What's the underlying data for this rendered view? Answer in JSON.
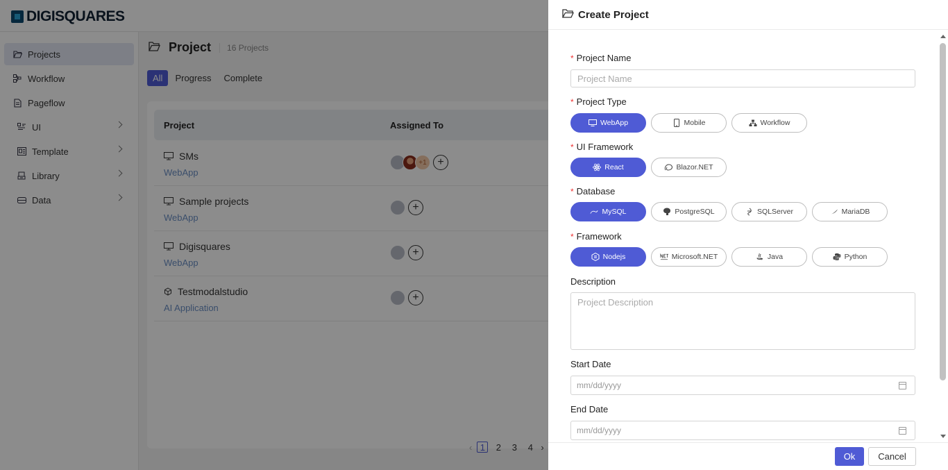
{
  "app": {
    "logo_text": "DIGISQUARES"
  },
  "sidebar": {
    "items": [
      {
        "label": "Projects"
      },
      {
        "label": "Workflow"
      },
      {
        "label": "Pageflow"
      },
      {
        "label": "UI"
      },
      {
        "label": "Template"
      },
      {
        "label": "Library"
      },
      {
        "label": "Data"
      }
    ]
  },
  "main": {
    "title": "Project",
    "count": "16 Projects",
    "filters": [
      "All",
      "Progress",
      "Complete"
    ],
    "table": {
      "headers": {
        "project": "Project",
        "assigned": "Assigned To"
      },
      "rows": [
        {
          "name": "SMs",
          "type": "WebApp",
          "extra": "+1"
        },
        {
          "name": "Sample projects",
          "type": "WebApp"
        },
        {
          "name": "Digisquares",
          "type": "WebApp"
        },
        {
          "name": "Testmodalstudio",
          "type": "AI Application"
        }
      ]
    },
    "pagination": {
      "pages": [
        "1",
        "2",
        "3",
        "4"
      ],
      "current": "1"
    }
  },
  "drawer": {
    "title": "Create Project",
    "project_name": {
      "label": "Project Name",
      "placeholder": "Project Name"
    },
    "project_type": {
      "label": "Project Type",
      "options": [
        "WebApp",
        "Mobile",
        "Workflow"
      ],
      "selected": "WebApp"
    },
    "ui_framework": {
      "label": "UI Framework",
      "options": [
        "React",
        "Blazor.NET"
      ],
      "selected": "React"
    },
    "database": {
      "label": "Database",
      "options": [
        "MySQL",
        "PostgreSQL",
        "SQLServer",
        "MariaDB"
      ],
      "selected": "MySQL"
    },
    "framework": {
      "label": "Framework",
      "options": [
        "Nodejs",
        "Microsoft.NET",
        "Java",
        "Python"
      ],
      "selected": "Nodejs"
    },
    "description": {
      "label": "Description",
      "placeholder": "Project Description"
    },
    "start_date": {
      "label": "Start Date",
      "placeholder": "mm/dd/yyyy"
    },
    "end_date": {
      "label": "End Date",
      "placeholder": "mm/dd/yyyy"
    },
    "ok_label": "Ok",
    "cancel_label": "Cancel"
  },
  "colors": {
    "accent": "#4f5bd5",
    "required": "#ee3333"
  }
}
